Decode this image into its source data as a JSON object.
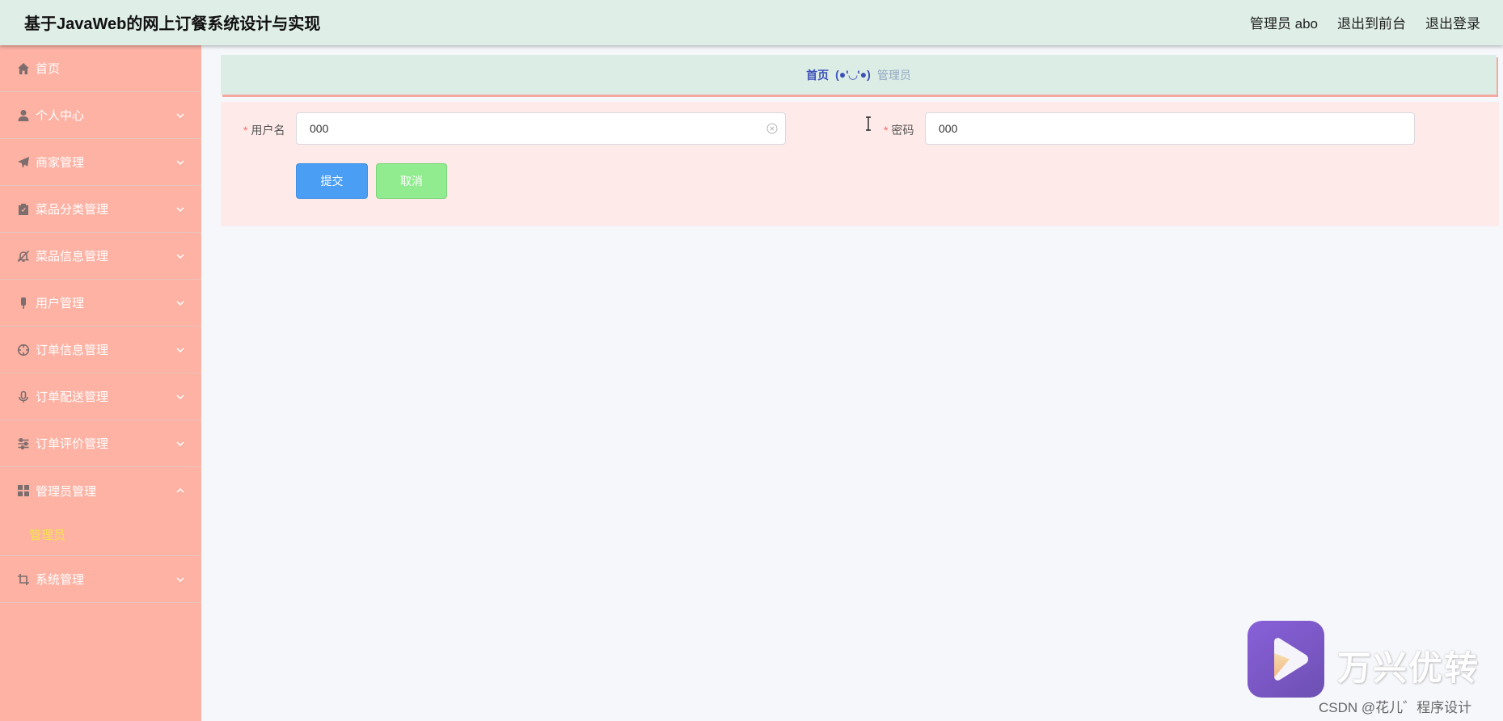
{
  "header": {
    "title": "基于JavaWeb的网上订餐系统设计与实现",
    "user_label": "管理员 abo",
    "back_front_label": "退出到前台",
    "logout_label": "退出登录"
  },
  "sidebar": {
    "items": [
      {
        "label": "首页",
        "icon": "home-icon"
      },
      {
        "label": "个人中心",
        "icon": "user-icon"
      },
      {
        "label": "商家管理",
        "icon": "paper-plane-icon"
      },
      {
        "label": "菜品分类管理",
        "icon": "clipboard-icon"
      },
      {
        "label": "菜品信息管理",
        "icon": "bell-off-icon"
      },
      {
        "label": "用户管理",
        "icon": "microphone-icon"
      },
      {
        "label": "订单信息管理",
        "icon": "crosshair-icon"
      },
      {
        "label": "订单配送管理",
        "icon": "mic-icon"
      },
      {
        "label": "订单评价管理",
        "icon": "sliders-icon"
      },
      {
        "label": "管理员管理",
        "icon": "grid-icon",
        "expanded": true,
        "children": [
          {
            "label": "管理员"
          }
        ]
      },
      {
        "label": "系统管理",
        "icon": "crop-icon"
      }
    ]
  },
  "breadcrumb": {
    "home": "首页",
    "separator": "(●'◡'●)",
    "current": "管理员"
  },
  "form": {
    "username_label": "用户名",
    "username_value": "000",
    "password_label": "密码",
    "password_value": "000",
    "required_mark": "*",
    "submit_label": "提交",
    "cancel_label": "取消"
  },
  "watermark": {
    "brand": "万兴优转",
    "credit": "CSDN @花儿゛程序设计"
  },
  "colors": {
    "header_bg": "#dfeee7",
    "sidebar_bg": "#fdb2a4",
    "submenu_active": "#f7e34a",
    "form_bg": "#feeae8",
    "submit_bg": "#4a9ff5",
    "cancel_bg": "#90ec8f"
  }
}
